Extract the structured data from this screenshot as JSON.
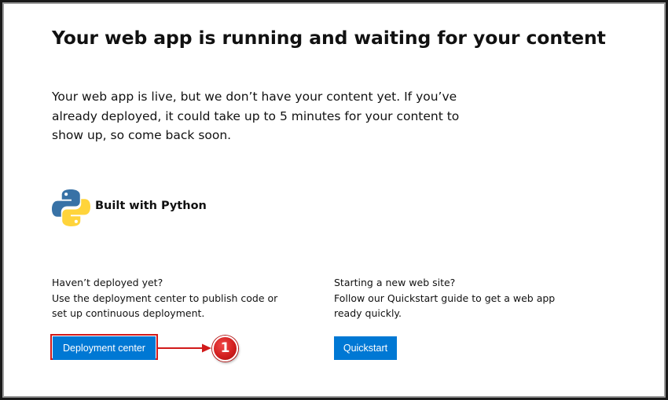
{
  "page": {
    "title": "Your web app is running and waiting for your content",
    "intro": "Your web app is live, but we don’t have your content yet. If you’ve already deployed, it could take up to 5 minutes for your content to show up, so come back soon."
  },
  "runtime": {
    "icon": "python-logo-icon",
    "label": "Built with Python"
  },
  "deploy_section": {
    "line1": "Haven’t deployed yet?",
    "line2": "Use the deployment center to publish code or set up continuous deployment.",
    "button_label": "Deployment center"
  },
  "quickstart_section": {
    "line1": "Starting a new web site?",
    "line2": "Follow our Quickstart guide to get a web app ready quickly.",
    "button_label": "Quickstart"
  },
  "annotation": {
    "step_number": "1",
    "color": "#d11a1a"
  },
  "colors": {
    "button": "#0078d4",
    "python_blue": "#3872a6",
    "python_yellow": "#ffd43b"
  }
}
